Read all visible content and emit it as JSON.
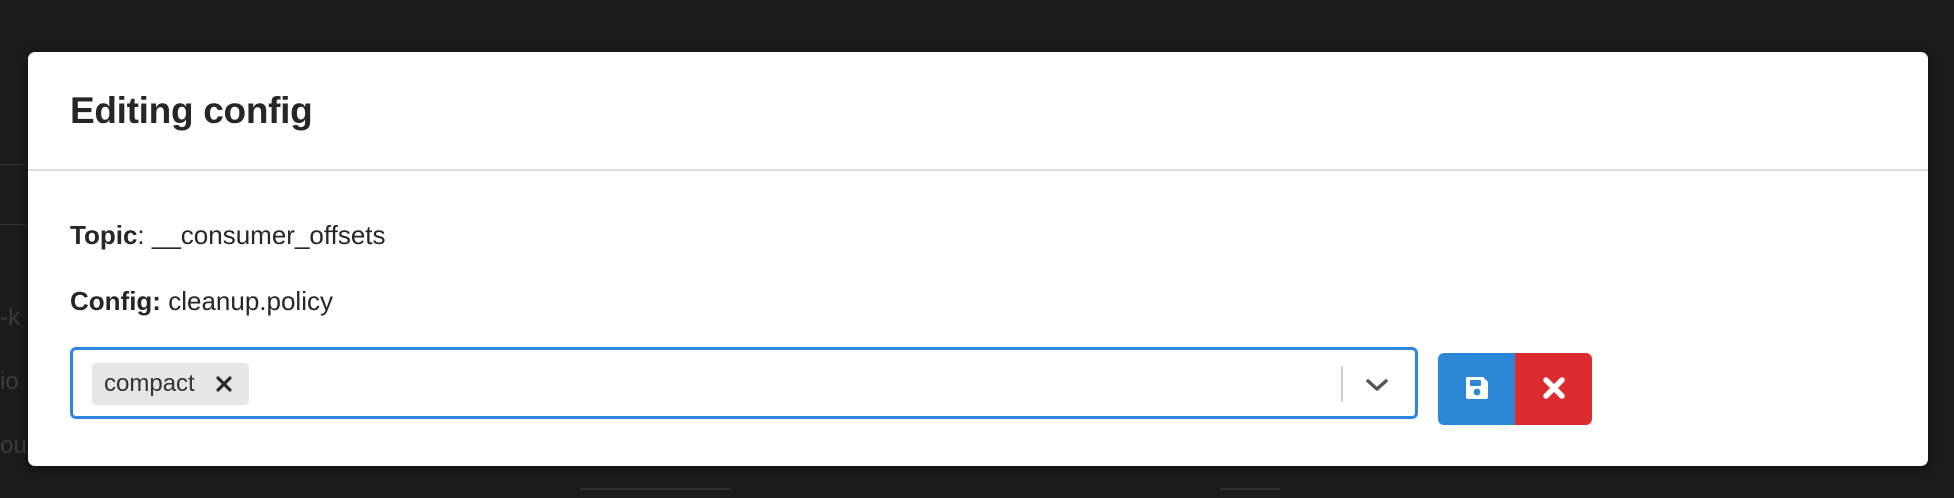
{
  "background_fragments": [
    "-k",
    "io",
    "ou"
  ],
  "modal": {
    "title": "Editing config",
    "topic": {
      "label": "Topic",
      "separator": ":",
      "value": "__consumer_offsets"
    },
    "config": {
      "label": "Config:",
      "value": "cleanup.policy"
    },
    "select": {
      "selected_tags": [
        "compact"
      ],
      "remove_icon": "x-icon",
      "dropdown_icon": "chevron-down-icon",
      "focus_color": "#2e86de"
    },
    "actions": {
      "save": {
        "icon": "floppy-disk-icon",
        "color": "#2c87d6"
      },
      "cancel": {
        "icon": "close-icon",
        "color": "#dc2c2f"
      }
    }
  }
}
